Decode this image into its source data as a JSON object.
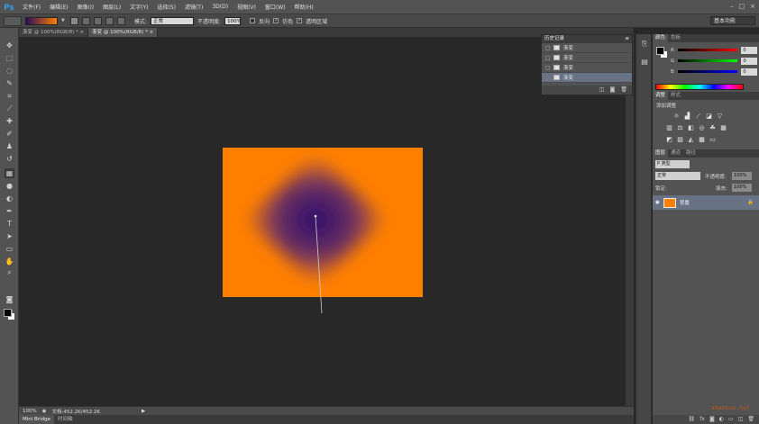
{
  "app": {
    "logo": "Ps"
  },
  "menu": [
    "文件(F)",
    "编辑(E)",
    "图像(I)",
    "图层(L)",
    "文字(Y)",
    "选择(S)",
    "滤镜(T)",
    "3D(D)",
    "视图(V)",
    "窗口(W)",
    "帮助(H)"
  ],
  "window_controls": {
    "minimize": "–",
    "restore": "□",
    "close": "×"
  },
  "options": {
    "mode_label": "模式:",
    "mode_value": "正常",
    "opacity_label": "不透明度:",
    "opacity_value": "100%",
    "reverse_label": "反向",
    "dither_label": "仿色",
    "transparency_label": "透明区域",
    "workspace": "基本功能",
    "gradient_colors": [
      "#2b0d5c",
      "#ff7f00"
    ]
  },
  "tabs": [
    {
      "label": "渐变 @ 100%(RGB/8) *",
      "close": "×"
    },
    {
      "label": "渐变 @ 100%(RGB/8) *",
      "close": "×"
    }
  ],
  "canvas": {
    "background": "#ff8000",
    "gradient_center": "#2a0b6e",
    "gradient_type": "diamond"
  },
  "status": {
    "zoom": "100%",
    "doc_info": "文档:452.2K/452.2K"
  },
  "bottom_tabs": [
    "Mini Bridge",
    "时间轴"
  ],
  "history": {
    "title": "历史记录",
    "items": [
      "渐变",
      "渐变",
      "渐变",
      "渐变"
    ]
  },
  "color_panel": {
    "tabs": [
      "颜色",
      "色板"
    ],
    "r": {
      "label": "R",
      "value": "0"
    },
    "g": {
      "label": "G",
      "value": "0"
    },
    "b": {
      "label": "B",
      "value": "0"
    }
  },
  "adjust_panel": {
    "tabs": [
      "调整",
      "样式"
    ],
    "title": "添加调整"
  },
  "layers_panel": {
    "tabs": [
      "图层",
      "通道",
      "路径"
    ],
    "kind_filter": "P 类型",
    "blend_mode": "正常",
    "opacity_label": "不透明度:",
    "opacity_value": "100%",
    "lock_label": "锁定:",
    "fill_label": "填充:",
    "fill_value": "100%",
    "layer_name": "背景"
  },
  "watermark": "shancun.net"
}
